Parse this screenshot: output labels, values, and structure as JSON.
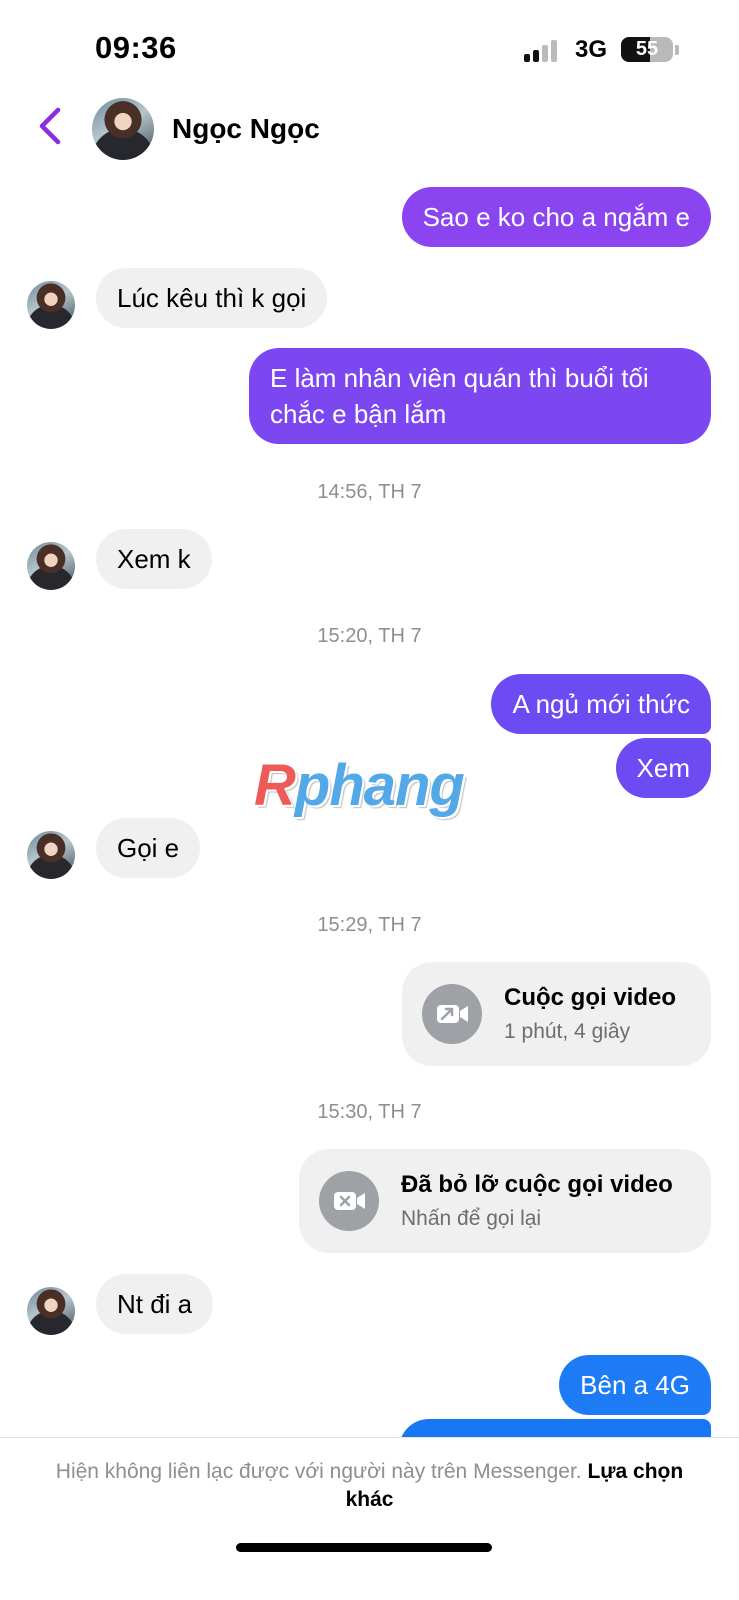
{
  "status_bar": {
    "time": "09:36",
    "network": "3G",
    "battery": "55"
  },
  "header": {
    "contact_name": "Ngọc Ngọc"
  },
  "messages": {
    "m1": "Sao e ko cho a ngắm e",
    "m2": "Lúc kêu thì k gọi",
    "m3": "E làm nhân viên quán thì buổi tối chắc e bận lắm",
    "t1": "14:56, TH 7",
    "m4": "Xem k",
    "t2": "15:20, TH 7",
    "m5": "A ngủ mới thức",
    "m6": "Xem",
    "m7": "Gọi e",
    "t3": "15:29, TH 7",
    "call1": {
      "title": "Cuộc gọi video",
      "subtitle": "1 phút, 4 giây"
    },
    "t4": "15:30, TH 7",
    "call2": {
      "title": "Đã bỏ lỡ cuộc gọi video",
      "subtitle": "Nhấn để gọi lại"
    },
    "m8": "Nt đi a",
    "m9": "Bên a 4G"
  },
  "watermark": {
    "first": "R",
    "rest": "phang"
  },
  "footer": {
    "notice": "Hiện không liên lạc được với người này trên Messenger.",
    "action": "Lựa chọn khác"
  },
  "colors": {
    "accent": "#8a2be2",
    "outgoing_purple": "#8a44f0",
    "outgoing_violet": "#6c4cf2",
    "outgoing_blue": "#1e7bf6",
    "incoming": "#f0f0f0"
  },
  "icons": [
    "chevron-left-icon",
    "video-call-icon",
    "missed-video-call-icon"
  ]
}
